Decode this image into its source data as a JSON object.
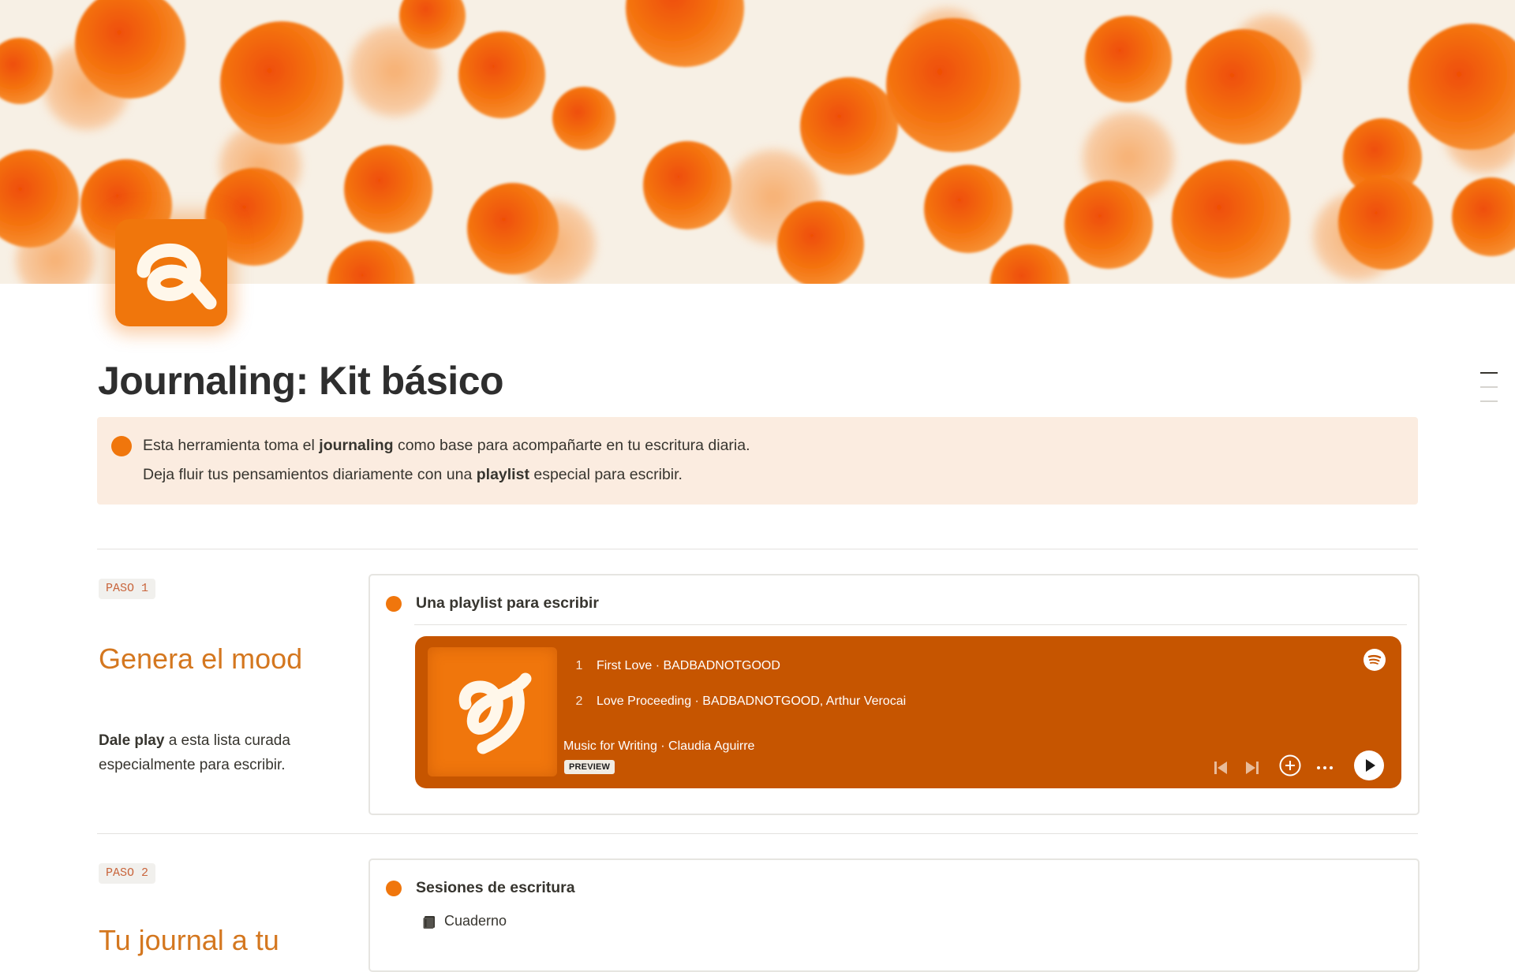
{
  "page": {
    "title": "Journaling: Kit básico",
    "cover_icon": "orange-polka-dot-cover",
    "page_icon": "orange-loop-logo-icon",
    "accent_color": "#f0760c",
    "callout_bg": "#fbece0"
  },
  "callout": {
    "icon": "orange-dot-icon",
    "line1": {
      "before": "Esta herramienta toma el ",
      "bold": "journaling",
      "after": " como base para acompañarte en tu escritura diaria."
    },
    "line2": {
      "before": "Deja fluir tus pensamientos diariamente con una ",
      "bold": "playlist",
      "after": " especial para escribir."
    }
  },
  "steps": [
    {
      "badge": "PASO 1",
      "title": "Genera el mood",
      "desc_bold": "Dale play",
      "desc_rest": " a esta lista curada especialmente para escribir.",
      "card": {
        "heading": "Una playlist para escribir",
        "player": {
          "color": "#c65500",
          "tracks": [
            {
              "number": "1",
              "name": "First Love · BADBADNOTGOOD"
            },
            {
              "number": "2",
              "name": "Love Proceeding · BADBADNOTGOOD, Arthur Verocai"
            }
          ],
          "playlist": "Music for Writing · Claudia Aguirre",
          "preview_label": "PREVIEW",
          "controls": [
            "previous-icon",
            "next-icon",
            "add-icon",
            "more-icon",
            "play-icon"
          ],
          "brand_icon": "spotify-icon"
        }
      }
    },
    {
      "badge": "PASO 2",
      "title": "Tu journal a tu",
      "card": {
        "heading": "Sesiones de escritura",
        "db_icon": "notebook-icon",
        "db_label": "Cuaderno"
      }
    }
  ]
}
